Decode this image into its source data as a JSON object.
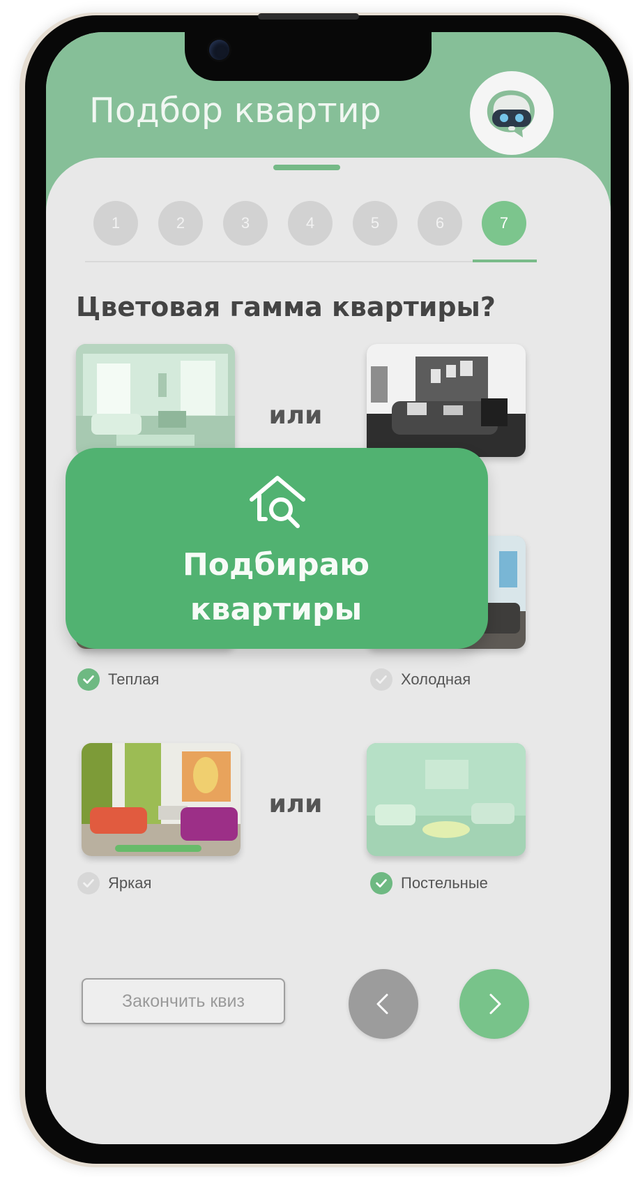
{
  "app": {
    "title": "Подбор квартир",
    "accent_color": "#51b271",
    "header_color": "#86bf98"
  },
  "header": {
    "assistant_icon": "robot-assistant-icon"
  },
  "progress": {
    "steps": [
      "1",
      "2",
      "3",
      "4",
      "5",
      "6",
      "7"
    ],
    "current_step": 7
  },
  "question": {
    "text": "Цветовая гамма квартиры?",
    "separator": "или",
    "options": [
      {
        "label": "Теплая",
        "selected": true
      },
      {
        "label": "Холодная",
        "selected": false
      },
      {
        "label": "Яркая",
        "selected": false
      },
      {
        "label": "Постельные",
        "selected": true
      }
    ]
  },
  "overlay": {
    "icon": "home-search-icon",
    "message": "Подбираю квартиры"
  },
  "actions": {
    "finish_label": "Закончить квиз",
    "back_icon": "chevron-left-icon",
    "next_icon": "chevron-right-icon"
  }
}
